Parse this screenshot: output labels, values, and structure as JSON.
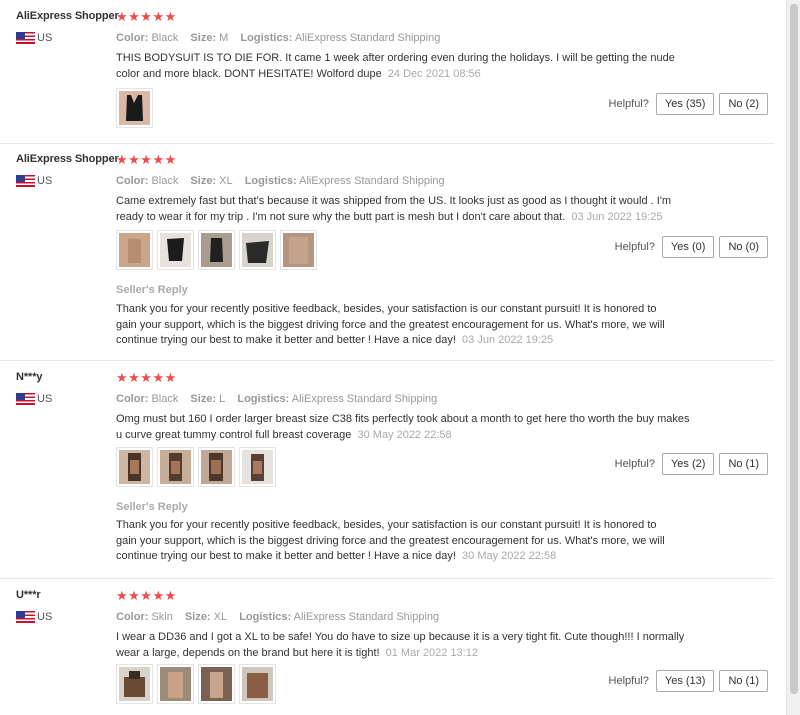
{
  "helpful_label": "Helpful?",
  "colors": {
    "star": "#f04a4a",
    "muted": "#999999",
    "date": "#aaaaaa"
  },
  "attr_labels": {
    "color": "Color:",
    "size": "Size:",
    "logistics": "Logistics:"
  },
  "seller_reply_title": "Seller's Reply",
  "reviews": [
    {
      "user": "AliExpress Shopper",
      "country": "US",
      "stars": "★★★★★",
      "rating": 5,
      "color": "Black",
      "size": "M",
      "logistics": "AliExpress Standard Shipping",
      "text": "THIS BODYSUIT IS TO DIE FOR. It came 1 week after ordering even during the holidays. I will be getting the nude color and more black. DONT HESITATE! Wolford dupe",
      "date": "24 Dec 2021 08:56",
      "photos": [
        {
          "alt": "black bodysuit photo"
        }
      ],
      "yes": "Yes (35)",
      "no": "No (2)"
    },
    {
      "user": "AliExpress Shopper",
      "country": "US",
      "stars": "★★★★★",
      "rating": 5,
      "color": "Black",
      "size": "XL",
      "logistics": "AliExpress Standard Shipping",
      "text": "Came extremely fast but that's because it was shipped from the US. It looks just as good as I thought it would . I'm ready to wear it for my trip . I'm not sure why the butt part is mesh but I don't care about that.",
      "date": "03 Jun 2022 19:25",
      "photos": [
        {
          "alt": "photo 1"
        },
        {
          "alt": "photo 2"
        },
        {
          "alt": "photo 3"
        },
        {
          "alt": "photo 4"
        },
        {
          "alt": "photo 5"
        }
      ],
      "yes": "Yes (0)",
      "no": "No (0)",
      "reply": "Thank you for your recently positive feedback, besides, your satisfaction is our constant pursuit! It is honored to gain your support, which is the biggest driving force and the greatest encouragement for us. What's more, we will continue trying our best to make it better and better ! Have a nice day!",
      "reply_date": "03 Jun 2022 19:25"
    },
    {
      "user": "N***y",
      "country": "US",
      "stars": "★★★★★",
      "rating": 5,
      "color": "Black",
      "size": "L",
      "logistics": "AliExpress Standard Shipping",
      "text": "Omg must but 160 I order larger breast size C38 fits perfectly took about a month to get here tho worth the buy makes u curve great tummy control full breast coverage",
      "date": "30 May 2022 22:58",
      "photos": [
        {
          "alt": "photo 1"
        },
        {
          "alt": "photo 2"
        },
        {
          "alt": "photo 3"
        },
        {
          "alt": "photo 4"
        }
      ],
      "yes": "Yes (2)",
      "no": "No (1)",
      "reply": "Thank you for your recently positive feedback, besides, your satisfaction is our constant pursuit! It is honored to gain your support, which is the biggest driving force and the greatest encouragement for us. What's more, we will continue trying our best to make it better and better ! Have a nice day!",
      "reply_date": "30 May 2022 22:58"
    },
    {
      "user": "U***r",
      "country": "US",
      "stars": "★★★★★",
      "rating": 5,
      "color": "Skin",
      "size": "XL",
      "logistics": "AliExpress Standard Shipping",
      "text": "I wear a DD36 and I got a XL to be safe! You do have to size up because it is a very tight fit. Cute though!!! I normally wear a large, depends on the brand but here it is tight!",
      "date": "01 Mar 2022 13:12",
      "photos": [
        {
          "alt": "photo 1"
        },
        {
          "alt": "photo 2"
        },
        {
          "alt": "photo 3"
        },
        {
          "alt": "photo 4"
        }
      ],
      "yes": "Yes (13)",
      "no": "No (1)"
    }
  ]
}
